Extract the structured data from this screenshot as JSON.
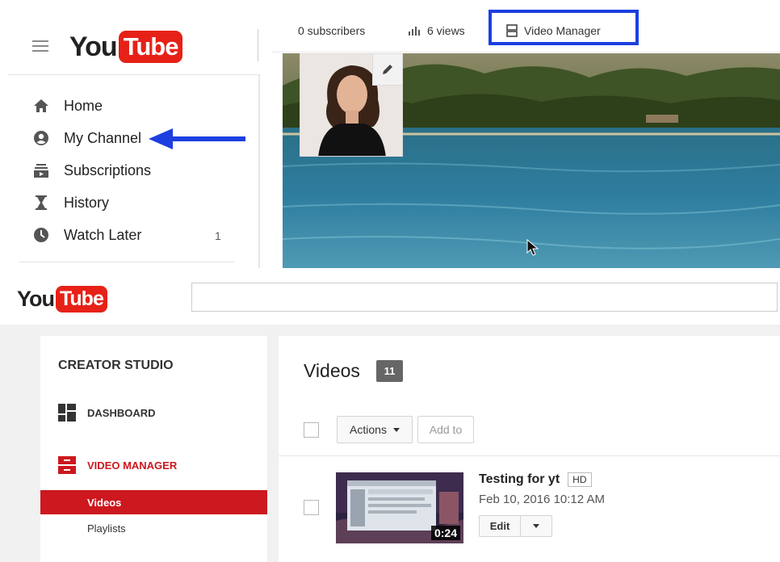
{
  "top_channel": {
    "logo": {
      "you": "You",
      "tube": "Tube"
    },
    "nav": [
      {
        "label": "Home",
        "icon": "home-icon"
      },
      {
        "label": "My Channel",
        "icon": "account-circle-icon"
      },
      {
        "label": "Subscriptions",
        "icon": "subscriptions-icon"
      },
      {
        "label": "History",
        "icon": "hourglass-icon"
      },
      {
        "label": "Watch Later",
        "icon": "clock-icon",
        "count": "1"
      }
    ],
    "stats": {
      "subscribers": "0 subscribers",
      "views": "6 views",
      "video_manager": "Video Manager"
    },
    "colors": {
      "highlight_box": "#1c3fe0",
      "arrow": "#1c3fe0",
      "brand": "#e62117"
    }
  },
  "creator_studio": {
    "logo": {
      "you": "You",
      "tube": "Tube"
    },
    "search": {
      "value": ""
    },
    "sidebar": {
      "title": "CREATOR STUDIO",
      "dashboard": "DASHBOARD",
      "video_manager": "VIDEO MANAGER",
      "sub_items": [
        "Videos",
        "Playlists"
      ]
    },
    "main": {
      "title": "Videos",
      "count": "11",
      "actions_label": "Actions",
      "add_to_label": "Add to",
      "video": {
        "title": "Testing for yt",
        "badge": "HD",
        "date": "Feb 10, 2016 10:12 AM",
        "duration": "0:24",
        "edit_label": "Edit"
      }
    },
    "colors": {
      "accent": "#cc181e"
    }
  }
}
